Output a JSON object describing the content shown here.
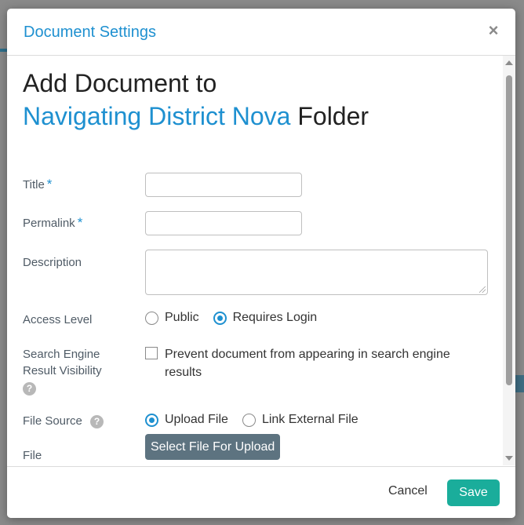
{
  "dialog": {
    "title": "Document Settings",
    "close_glyph": "×"
  },
  "heading": {
    "line1": "Add Document to",
    "folder_name": "Navigating District Nova",
    "folder_suffix": " Folder"
  },
  "form": {
    "title_label": "Title",
    "permalink_label": "Permalink",
    "required_mark": "*",
    "description_label": "Description",
    "access_level_label": "Access Level",
    "access_options": [
      {
        "label": "Public",
        "checked": false
      },
      {
        "label": "Requires Login",
        "checked": true
      }
    ],
    "search_visibility_label": "Search Engine Result Visibility",
    "search_visibility_checkbox": "Prevent document from appearing in search engine results",
    "file_source_label": "File Source",
    "file_source_options": [
      {
        "label": "Upload File",
        "checked": true
      },
      {
        "label": "Link External File",
        "checked": false
      }
    ],
    "file_label": "File",
    "upload_button": "Select File For Upload",
    "help_glyph": "?"
  },
  "footer": {
    "cancel_label": "Cancel",
    "save_label": "Save"
  },
  "colors": {
    "accent": "#1e90d0",
    "save": "#1aad9b",
    "upload": "#5d7380"
  }
}
